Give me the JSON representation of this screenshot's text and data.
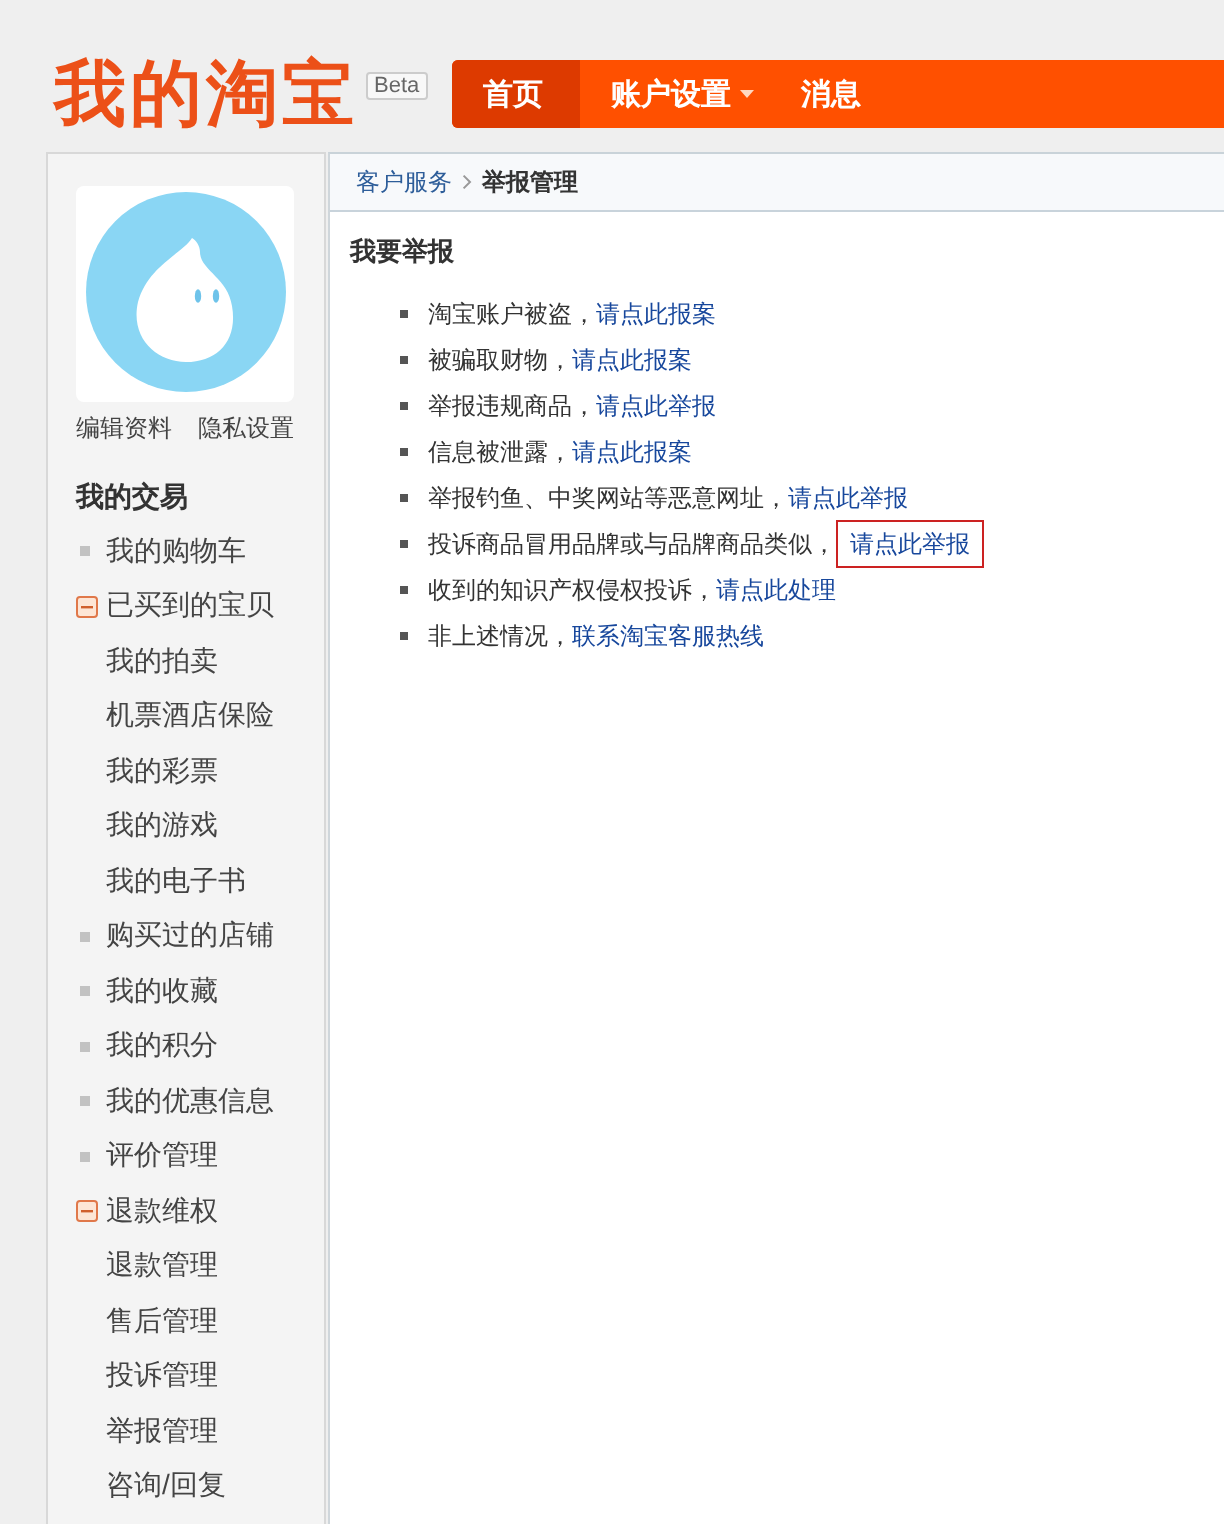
{
  "logo": "我的淘宝",
  "beta_badge": "Beta",
  "nav": {
    "tabs": [
      {
        "label": "首页",
        "selected": true,
        "dropdown": false
      },
      {
        "label": "账户设置",
        "selected": false,
        "dropdown": true
      },
      {
        "label": "消息",
        "selected": false,
        "dropdown": false
      }
    ]
  },
  "sidebar": {
    "profile_links": [
      "编辑资料",
      "隐私设置"
    ],
    "section_title": "我的交易",
    "items": [
      {
        "kind": "link",
        "label": "我的购物车"
      },
      {
        "kind": "group",
        "label": "已买到的宝贝",
        "expanded": true,
        "children": [
          {
            "label": "我的拍卖"
          },
          {
            "label": "机票酒店保险"
          },
          {
            "label": "我的彩票"
          },
          {
            "label": "我的游戏"
          },
          {
            "label": "我的电子书"
          }
        ]
      },
      {
        "kind": "link",
        "label": "购买过的店铺"
      },
      {
        "kind": "link",
        "label": "我的收藏"
      },
      {
        "kind": "link",
        "label": "我的积分"
      },
      {
        "kind": "link",
        "label": "我的优惠信息"
      },
      {
        "kind": "link",
        "label": "评价管理"
      },
      {
        "kind": "group",
        "label": "退款维权",
        "expanded": true,
        "children": [
          {
            "label": "退款管理"
          },
          {
            "label": "售后管理"
          },
          {
            "label": "投诉管理"
          },
          {
            "label": "举报管理"
          },
          {
            "label": "咨询/回复"
          }
        ]
      }
    ]
  },
  "breadcrumb": [
    {
      "kind": "link",
      "label": "客户服务"
    },
    {
      "kind": "current",
      "label": "举报管理"
    }
  ],
  "report": {
    "title": "我要举报",
    "items": [
      {
        "text": "淘宝账户被盗，",
        "link": "请点此报案",
        "highlighted": false
      },
      {
        "text": "被骗取财物，",
        "link": "请点此报案",
        "highlighted": false
      },
      {
        "text": "举报违规商品，",
        "link": "请点此举报",
        "highlighted": false
      },
      {
        "text": "信息被泄露，",
        "link": "请点此报案",
        "highlighted": false
      },
      {
        "text": "举报钓鱼、中奖网站等恶意网址，",
        "link": "请点此举报",
        "highlighted": false
      },
      {
        "text": "投诉商品冒用品牌或与品牌商品类似，",
        "link": "请点此举报",
        "highlighted": true
      },
      {
        "text": "收到的知识产权侵权投诉，",
        "link": "请点此处理",
        "highlighted": false
      },
      {
        "text": "非上述情况，",
        "link": "联系淘宝客服热线",
        "highlighted": false
      }
    ]
  }
}
